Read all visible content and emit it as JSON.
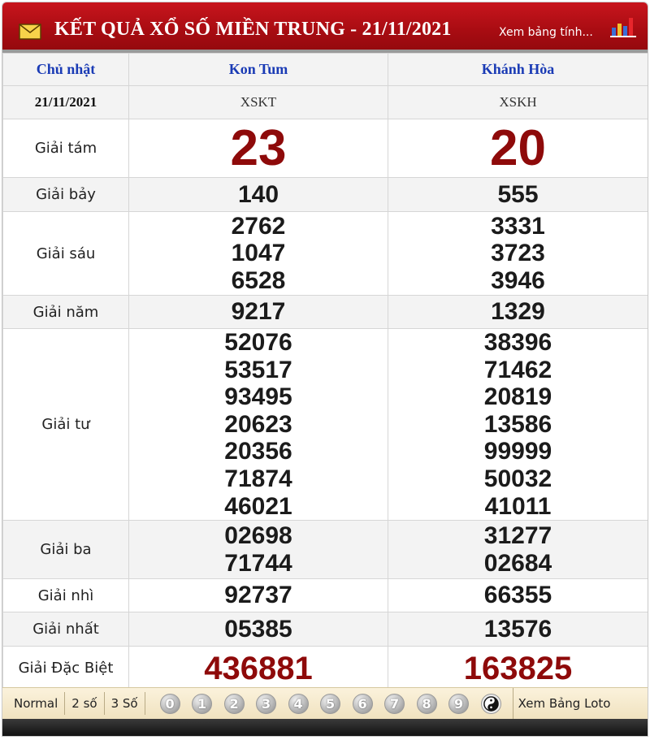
{
  "header": {
    "title": "KẾT QUẢ XỔ SỐ MIỀN TRUNG - 21/11/2021",
    "view_link": "Xem bảng tính...",
    "mail_icon": "envelope-icon",
    "chart_icon": "bar-chart-icon"
  },
  "table": {
    "day": "Chủ nhật",
    "date": "21/11/2021",
    "provinces": [
      {
        "name": "Kon Tum",
        "code": "XSKT"
      },
      {
        "name": "Khánh Hòa",
        "code": "XSKH"
      }
    ],
    "prizes": {
      "g8": {
        "label": "Giải tám",
        "values": [
          [
            "23"
          ],
          [
            "20"
          ]
        ]
      },
      "g7": {
        "label": "Giải bảy",
        "values": [
          [
            "140"
          ],
          [
            "555"
          ]
        ]
      },
      "g6": {
        "label": "Giải sáu",
        "values": [
          [
            "2762",
            "1047",
            "6528"
          ],
          [
            "3331",
            "3723",
            "3946"
          ]
        ]
      },
      "g5": {
        "label": "Giải năm",
        "values": [
          [
            "9217"
          ],
          [
            "1329"
          ]
        ]
      },
      "g4": {
        "label": "Giải tư",
        "values": [
          [
            "52076",
            "53517",
            "93495",
            "20623",
            "20356",
            "71874",
            "46021"
          ],
          [
            "38396",
            "71462",
            "20819",
            "13586",
            "99999",
            "50032",
            "41011"
          ]
        ]
      },
      "g3": {
        "label": "Giải ba",
        "values": [
          [
            "02698",
            "71744"
          ],
          [
            "31277",
            "02684"
          ]
        ]
      },
      "g2": {
        "label": "Giải nhì",
        "values": [
          [
            "92737"
          ],
          [
            "66355"
          ]
        ]
      },
      "g1": {
        "label": "Giải nhất",
        "values": [
          [
            "05385"
          ],
          [
            "13576"
          ]
        ]
      },
      "db": {
        "label": "Giải Đặc Biệt",
        "values": [
          [
            "436881"
          ],
          [
            "163825"
          ]
        ]
      }
    }
  },
  "footer": {
    "options": [
      "Normal",
      "2 số",
      "3 Số"
    ],
    "digits": [
      "0",
      "1",
      "2",
      "3",
      "4",
      "5",
      "6",
      "7",
      "8",
      "9"
    ],
    "yinyang_icon": "yin-yang-icon",
    "loto_link": "Xem Bảng Loto"
  },
  "colors": {
    "header_red": "#b0121a",
    "province_blue": "#1a3bb5",
    "prize_red": "#8e0a0a",
    "footer_cream": "#f5ead0"
  }
}
